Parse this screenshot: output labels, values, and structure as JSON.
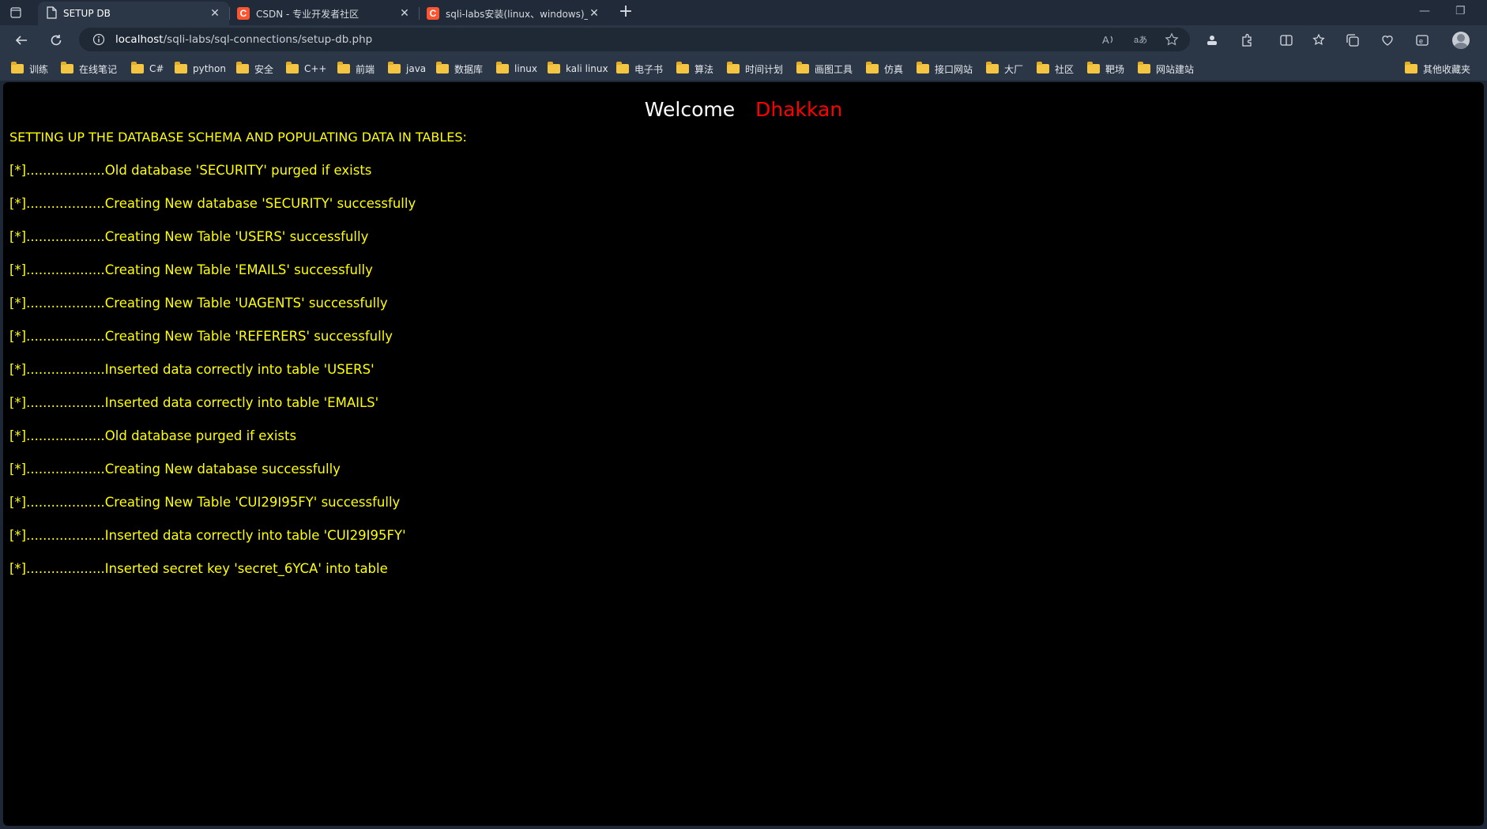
{
  "tabs": [
    {
      "title": "SETUP DB",
      "icon": "page-icon",
      "active": true
    },
    {
      "title": "CSDN - 专业开发者社区",
      "icon": "csdn-icon",
      "active": false
    },
    {
      "title": "sqli-labs安装(linux、windows)_sqli",
      "icon": "csdn-icon",
      "active": false
    }
  ],
  "favicon_letter": "C",
  "address": {
    "host": "localhost",
    "path": "/sqli-labs/sql-connections/setup-db.php"
  },
  "bookmarks": [
    "训练",
    "在线笔记",
    "C#",
    "python",
    "安全",
    "C++",
    "前端",
    "java",
    "数据库",
    "linux",
    "kali linux",
    "电子书",
    "算法",
    "时间计划",
    "画图工具",
    "仿真",
    "接口网站",
    "大厂",
    "社区",
    "靶场",
    "网站建站",
    "其他收藏夹"
  ],
  "page": {
    "welcome": "Welcome",
    "name": "Dhakkan",
    "heading": "SETTING UP THE DATABASE SCHEMA AND POPULATING DATA IN TABLES:",
    "log": [
      "[*]...................Old database 'SECURITY' purged if exists",
      "[*]...................Creating New database 'SECURITY' successfully",
      "[*]...................Creating New Table 'USERS' successfully",
      "[*]...................Creating New Table 'EMAILS' successfully",
      "[*]...................Creating New Table 'UAGENTS' successfully",
      "[*]...................Creating New Table 'REFERERS' successfully",
      "[*]...................Inserted data correctly into table 'USERS'",
      "[*]...................Inserted data correctly into table 'EMAILS'",
      "[*]...................Old database purged if exists",
      "[*]...................Creating New database successfully",
      "[*]...................Creating New Table 'CUI29I95FY' successfully",
      "[*]...................Inserted data correctly into table 'CUI29I95FY'",
      "[*]...................Inserted secret key 'secret_6YCA' into table"
    ]
  },
  "colors": {
    "page_bg": "#000000",
    "log_text": "#ffff00",
    "welcome": "#ffffff",
    "name": "#ff0000"
  }
}
